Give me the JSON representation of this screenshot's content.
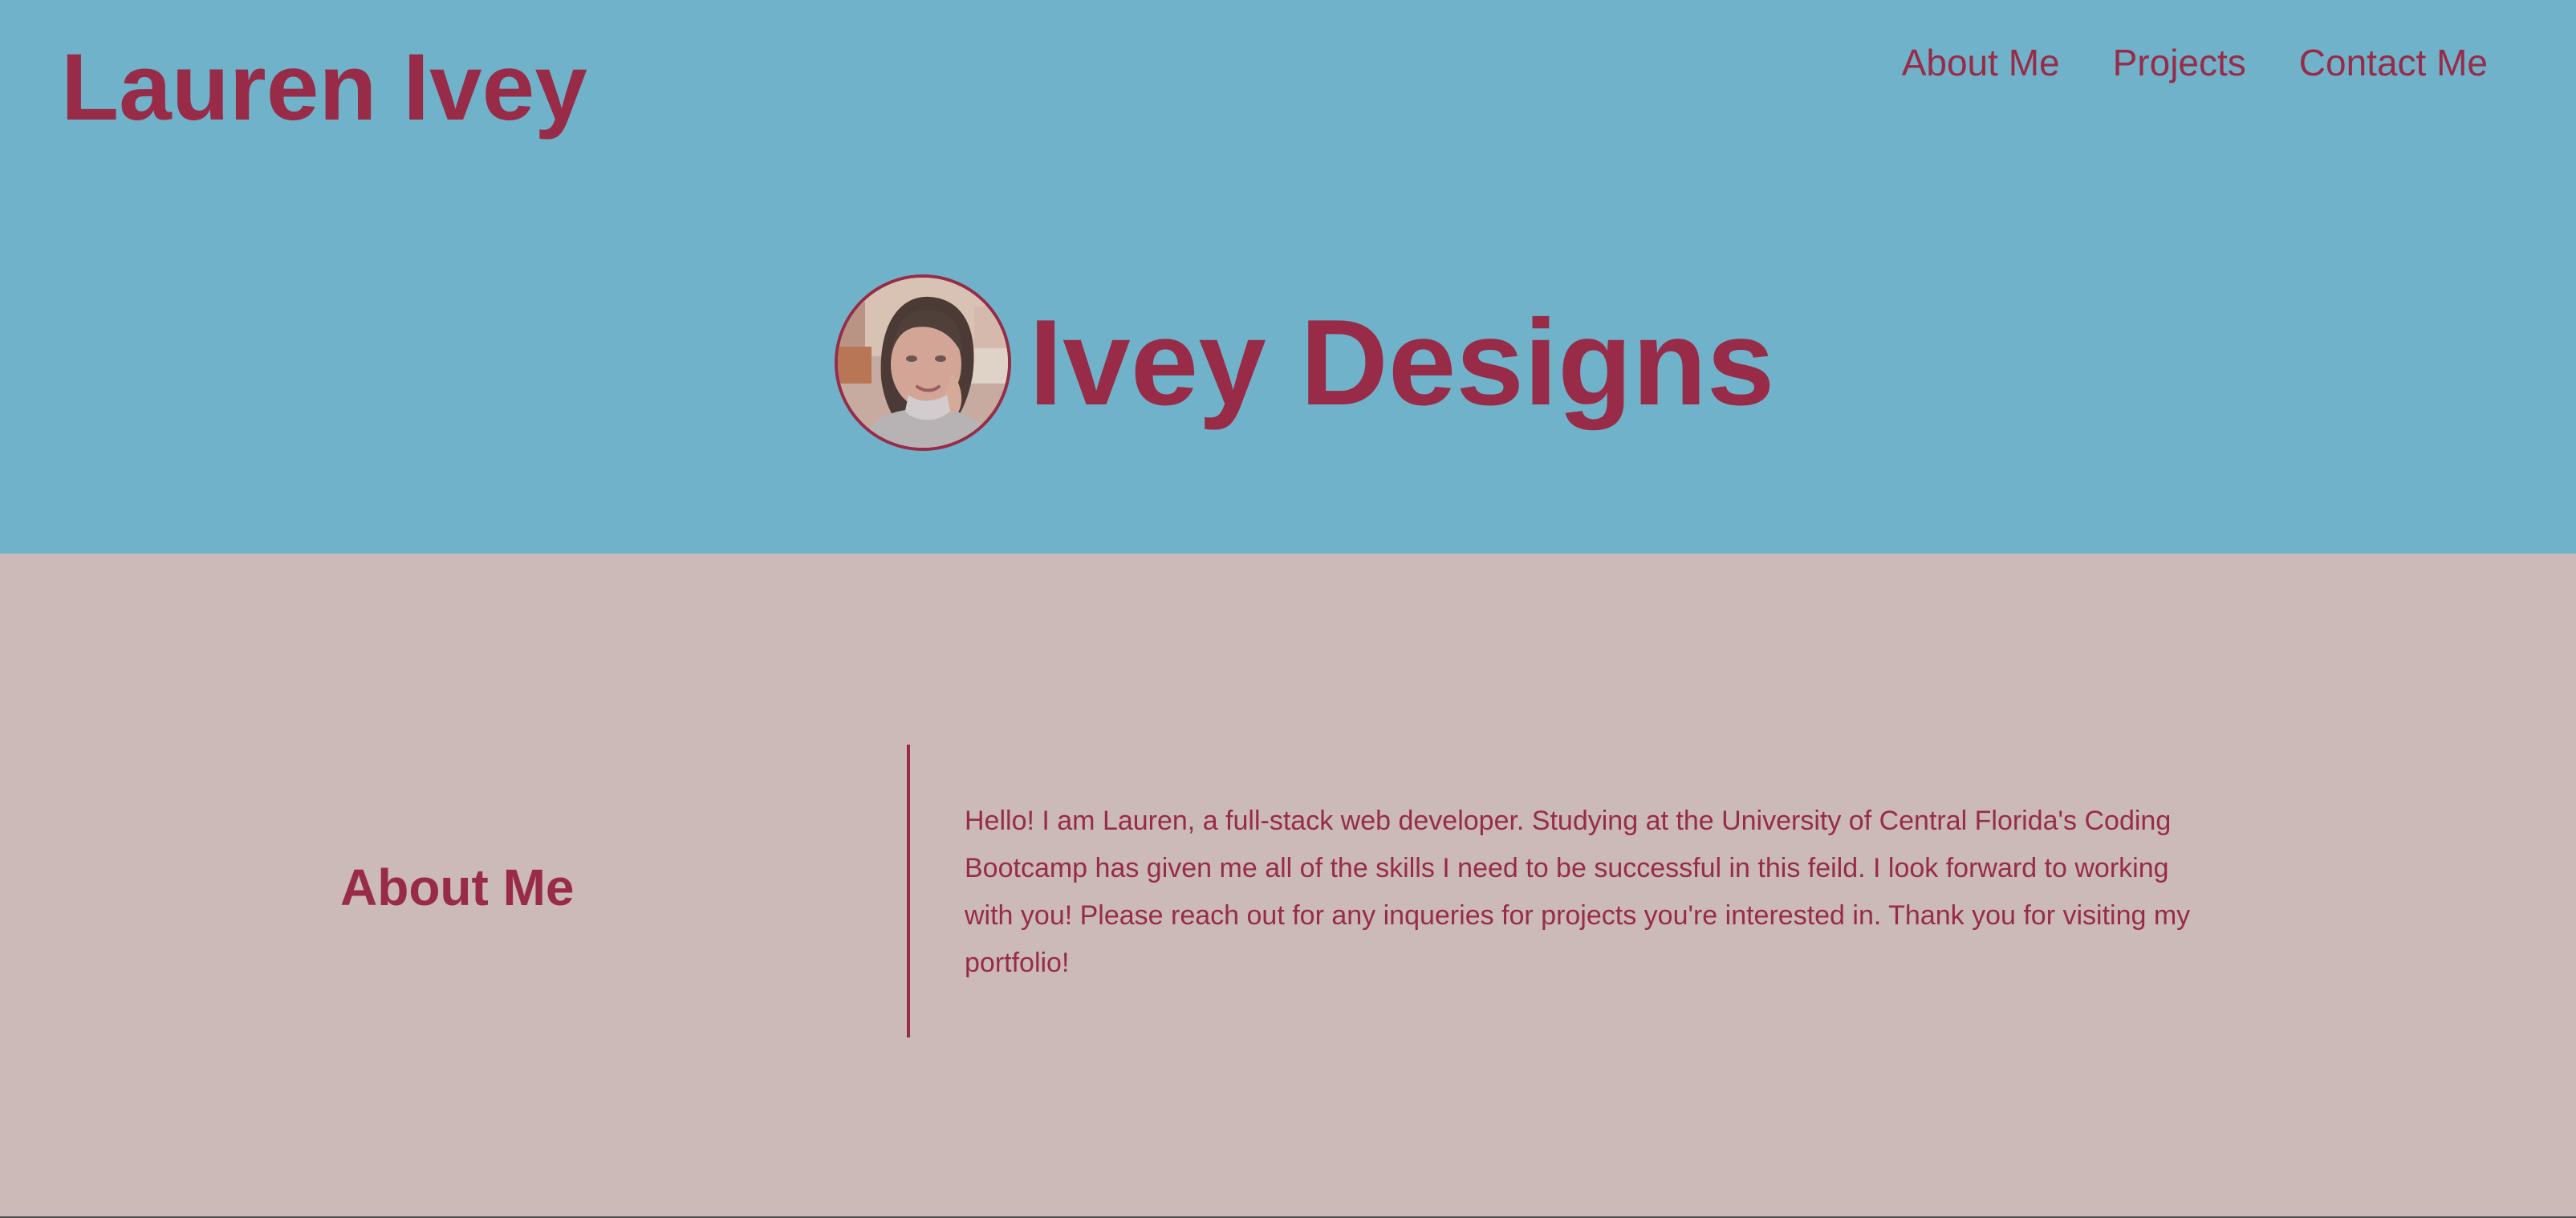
{
  "header": {
    "site_title": "Lauren Ivey",
    "nav": [
      {
        "label": "About Me"
      },
      {
        "label": "Projects"
      },
      {
        "label": "Contact Me"
      }
    ]
  },
  "hero": {
    "avatar_icon": "profile-photo-icon",
    "title": "Ivey Designs"
  },
  "about": {
    "heading": "About Me",
    "body": "Hello! I am Lauren, a full-stack web developer. Studying at the University of Central Florida's Coding Bootcamp has given me all of the skills I need to be successful in this feild. I look forward to working with you! Please reach out for any inqueries for projects you're interested in. Thank you for visiting my portfolio!"
  },
  "colors": {
    "header_background": "#6fb2c9",
    "body_background": "#cbbab8",
    "accent": "#982c48"
  }
}
